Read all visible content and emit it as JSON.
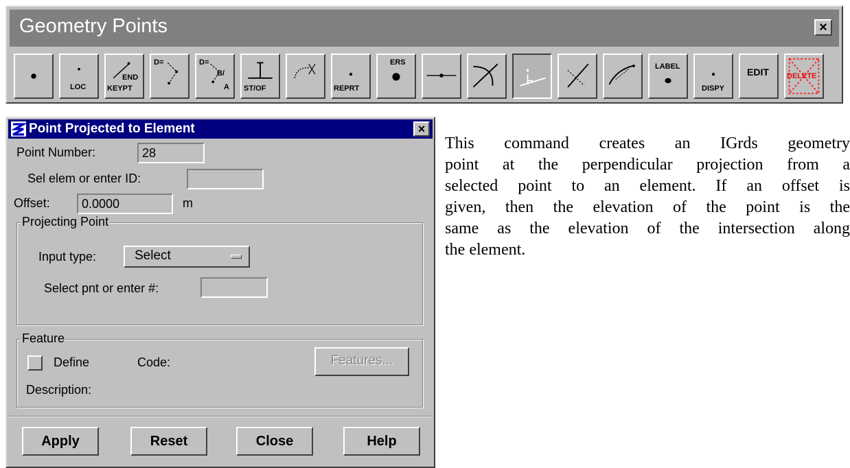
{
  "toolbar": {
    "title": "Geometry Points",
    "close": "×",
    "buttons": [
      {
        "id": "point",
        "icon": "dot-icon",
        "labels": []
      },
      {
        "id": "loc",
        "icon": "loc-point-icon",
        "labels": [
          "LOC"
        ]
      },
      {
        "id": "endkeypt",
        "icon": "end-keypoint-icon",
        "labels": [
          "END",
          "KEYPT"
        ]
      },
      {
        "id": "dist-dir",
        "icon": "distance-direction-icon",
        "labels": [
          "D="
        ]
      },
      {
        "id": "dist-ba",
        "icon": "distance-bearing-icon",
        "labels": [
          "D=",
          "B/",
          "A"
        ]
      },
      {
        "id": "stof",
        "icon": "station-offset-icon",
        "labels": [
          "ST/OF"
        ]
      },
      {
        "id": "arc",
        "icon": "arc-point-icon",
        "labels": []
      },
      {
        "id": "reprt",
        "icon": "report-icon",
        "labels": [
          "REPRT"
        ]
      },
      {
        "id": "ers",
        "icon": "erase-icon",
        "labels": [
          "ERS"
        ]
      },
      {
        "id": "on-line",
        "icon": "point-on-line-icon",
        "labels": []
      },
      {
        "id": "intersect",
        "icon": "intersect-arc-icon",
        "labels": []
      },
      {
        "id": "project",
        "icon": "project-to-element-icon",
        "labels": [],
        "pressed": true
      },
      {
        "id": "perp",
        "icon": "perpendicular-icon",
        "labels": []
      },
      {
        "id": "curve",
        "icon": "point-on-curve-icon",
        "labels": []
      },
      {
        "id": "label",
        "icon": "label-icon",
        "labels": [
          "LABEL"
        ]
      },
      {
        "id": "dispy",
        "icon": "display-icon",
        "labels": [
          "DISPY"
        ]
      },
      {
        "id": "edit",
        "icon": "edit-icon",
        "labels": [
          "EDIT"
        ]
      },
      {
        "id": "delete",
        "icon": "delete-icon",
        "labels": [
          "DELETE"
        ]
      }
    ]
  },
  "dialog": {
    "title": "Point Projected to Element",
    "close": "×",
    "point_number_label": "Point Number:",
    "point_number_value": "28",
    "sel_elem_label": "Sel elem or enter ID:",
    "sel_elem_value": "",
    "offset_label": "Offset:",
    "offset_value": "0.0000",
    "offset_unit": "m",
    "projecting_group": "Projecting Point",
    "input_type_label": "Input type:",
    "input_type_value": "Select",
    "select_pnt_label": "Select pnt or enter #:",
    "select_pnt_value": "",
    "feature_group": "Feature",
    "define_label": "Define",
    "code_label": "Code:",
    "features_button": "Features...",
    "description_label": "Description:",
    "buttons": {
      "apply": "Apply",
      "reset": "Reset",
      "close": "Close",
      "help": "Help"
    }
  },
  "description_lines": [
    "This command creates an IGrds geometry",
    "point at the perpendicular projection from a",
    "selected point to an element.  If an offset is",
    "given, then the elevation of the point is the",
    "same as the elevation of the intersection along",
    "the element."
  ]
}
